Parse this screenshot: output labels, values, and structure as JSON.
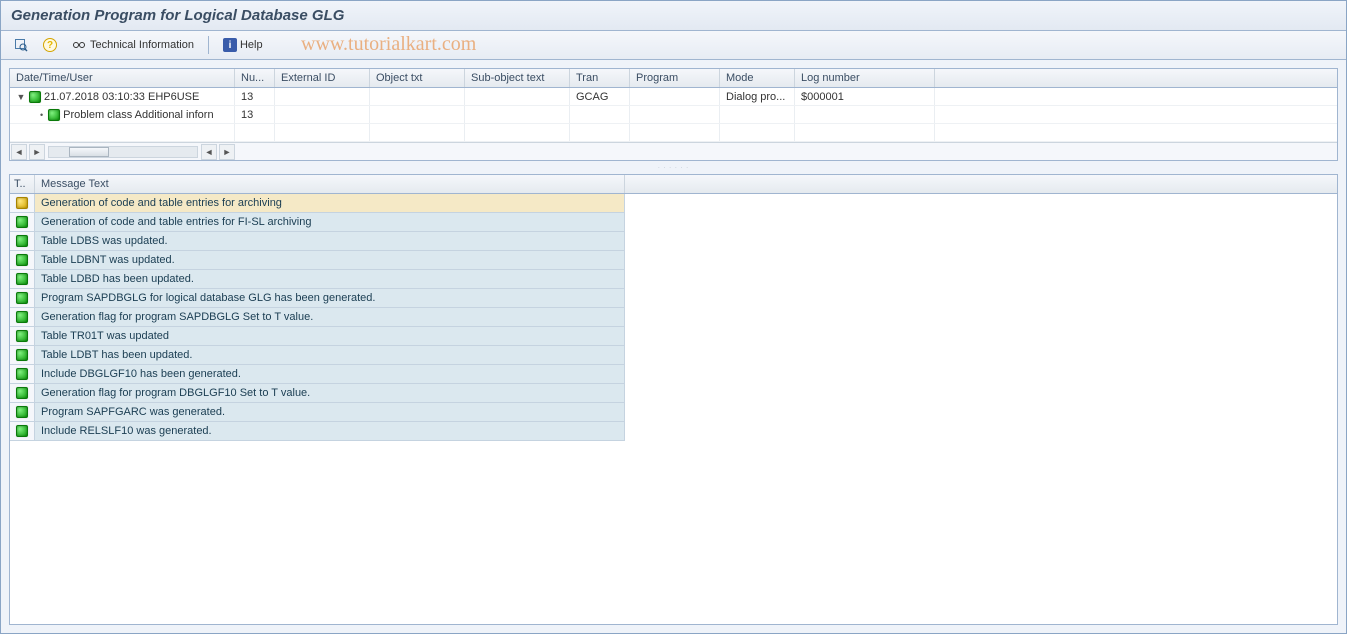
{
  "window_title": "Generation Program for Logical Database GLG",
  "toolbar": {
    "tech_info_label": "Technical Information",
    "help_label": "Help"
  },
  "watermark": "www.tutorialkart.com",
  "log_grid": {
    "headers": {
      "date": "Date/Time/User",
      "nu": "Nu...",
      "ext": "External ID",
      "obj": "Object txt",
      "sub": "Sub-object text",
      "tran": "Tran",
      "prog": "Program",
      "mode": "Mode",
      "log": "Log number"
    },
    "rows": [
      {
        "level": 0,
        "text": "21.07.2018  03:10:33  EHP6USE",
        "nu": "13",
        "tran": "GCAG",
        "mode": "Dialog pro...",
        "log": "$000001"
      },
      {
        "level": 1,
        "text": "Problem class Additional inforn",
        "nu": "13"
      }
    ]
  },
  "msg_grid": {
    "header_t": "T..",
    "header_txt": "Message Text",
    "rows": [
      {
        "status": "yellow",
        "text": "Generation of code and table entries for archiving"
      },
      {
        "status": "green",
        "text": "Generation of code and table entries for FI-SL archiving"
      },
      {
        "status": "green",
        "text": "Table LDBS was updated."
      },
      {
        "status": "green",
        "text": "Table LDBNT was updated."
      },
      {
        "status": "green",
        "text": "Table LDBD has been updated."
      },
      {
        "status": "green",
        "text": "Program SAPDBGLG for logical database GLG has been generated."
      },
      {
        "status": "green",
        "text": "Generation flag for program SAPDBGLG Set to T value."
      },
      {
        "status": "green",
        "text": "Table TR01T was updated"
      },
      {
        "status": "green",
        "text": "Table LDBT has been updated."
      },
      {
        "status": "green",
        "text": "Include DBGLGF10 has been generated."
      },
      {
        "status": "green",
        "text": "Generation flag for program DBGLGF10 Set to T value."
      },
      {
        "status": "green",
        "text": "Program SAPFGARC was generated."
      },
      {
        "status": "green",
        "text": "Include RELSLF10 was generated."
      }
    ]
  }
}
